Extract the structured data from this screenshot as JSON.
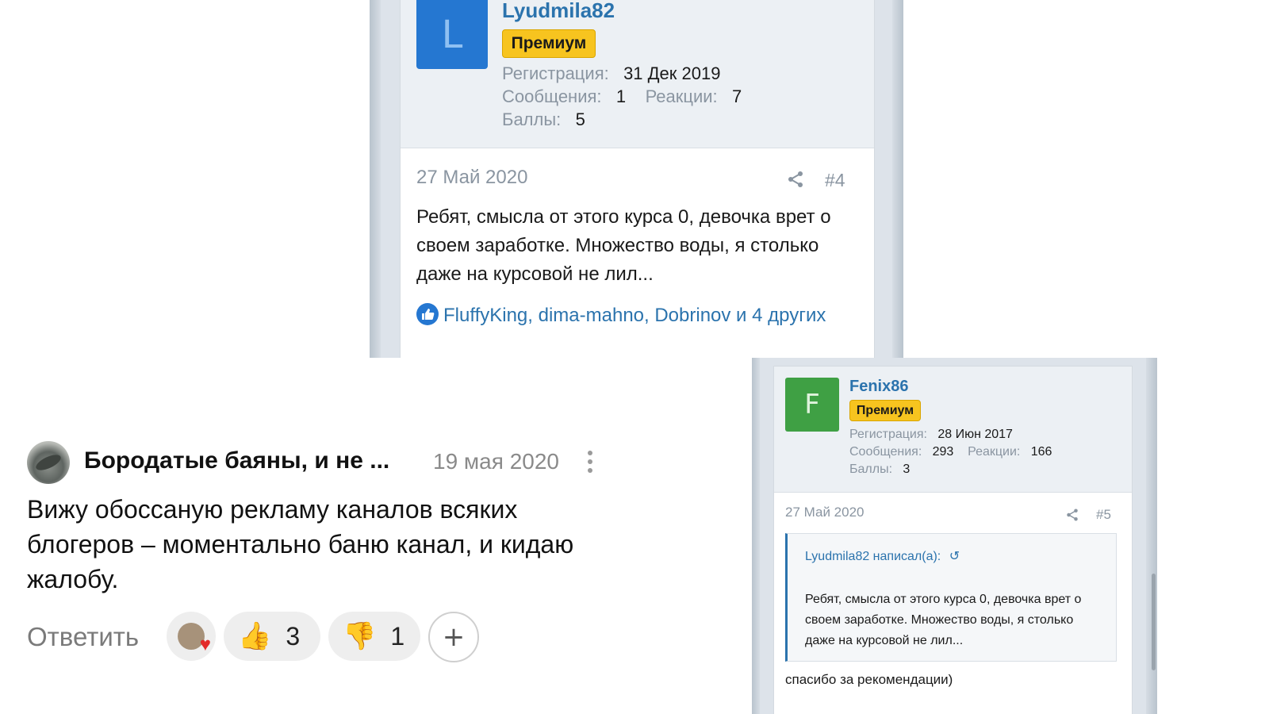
{
  "top_post": {
    "username": "Lyudmila82",
    "avatar_letter": "L",
    "badge": "Премиум",
    "reg_label": "Регистрация:",
    "reg_value": "31 Дек 2019",
    "msgs_label": "Сообщения:",
    "msgs_value": "1",
    "reactions_label": "Реакции:",
    "reactions_value": "7",
    "points_label": "Баллы:",
    "points_value": "5",
    "date": "27 Май 2020",
    "post_number": "#4",
    "text": "Ребят, смысла от этого курса 0, девочка врет о своем заработке. Множество воды, я столько даже на курсовой не лил...",
    "likes": "FluffyKing, dima-mahno, Dobrinov и 4 других",
    "colors": {
      "link": "#2b73ad",
      "avatar": "#2577d1",
      "badge": "#f7c41f"
    }
  },
  "comment": {
    "author": "Бородатые баяны, и не ...",
    "date": "19 мая 2020",
    "text": "Вижу обоссаную рекламу каналов всяких блогеров – моментально баню канал, и кидаю жалобу.",
    "reply_label": "Ответить",
    "like_emoji": "👍",
    "like_count": "3",
    "dislike_emoji": "👎",
    "dislike_count": "1",
    "add_reaction": "+"
  },
  "reply_post": {
    "username": "Fenix86",
    "avatar_letter": "F",
    "badge": "Премиум",
    "reg_label": "Регистрация:",
    "reg_value": "28 Июн 2017",
    "msgs_label": "Сообщения:",
    "msgs_value": "293",
    "reactions_label": "Реакции:",
    "reactions_value": "166",
    "points_label": "Баллы:",
    "points_value": "3",
    "date": "27 Май 2020",
    "post_number": "#5",
    "quote_author": "Lyudmila82 написал(а):",
    "quote_icon": "↺",
    "quote_text": "Ребят, смысла от этого курса 0, девочка врет о своем заработке. Множество воды, я столько даже на курсовой не лил...",
    "text": "спасибо за рекомендации)",
    "colors": {
      "avatar": "#3fa044"
    }
  }
}
